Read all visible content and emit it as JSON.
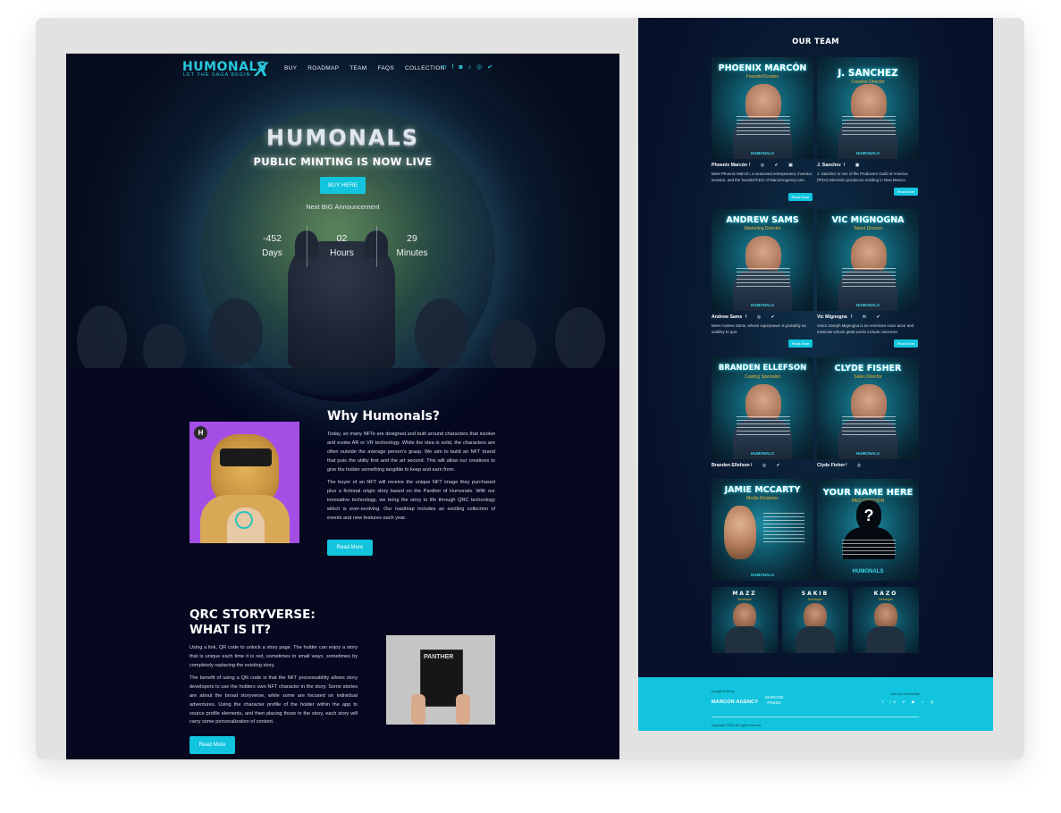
{
  "colors": {
    "accent": "#12c4de",
    "dark_bg": "#05081f",
    "frame_bg": "#e2e2e2",
    "role_gold": "#f2b233"
  },
  "left": {
    "nav": {
      "logo": "HUMONALS",
      "logo_x": "X",
      "logo_tagline": "LET THE SAGA BEGIN",
      "links": [
        "BUY",
        "ROADMAP",
        "TEAM",
        "FAQS",
        "COLLECTION"
      ],
      "social_icons": [
        "linkedin-icon",
        "facebook-icon",
        "discord-icon",
        "tiktok-icon",
        "instagram-icon",
        "twitter-icon"
      ]
    },
    "hero": {
      "title": "HUMONALS",
      "subtitle": "PUBLIC MINTING IS NOW LIVE",
      "buy_label": "BUY HERE",
      "announce": "Next BIG Announcement",
      "countdown": [
        {
          "value": "-452",
          "label": "Days"
        },
        {
          "value": "02",
          "label": "Hours"
        },
        {
          "value": "29",
          "label": "Minutes"
        }
      ]
    },
    "why": {
      "title": "Why Humonals?",
      "p1": "Today, so many NFTs are designed and built around characters that involve and evoke AR or VR technology. While the idea is solid, the characters are often outside the average person's grasp. We aim to build an NFT brand that puts the utility first and the art second. This will allow our creations to give the holder something tangible to keep and earn from.",
      "p2": "The buyer of an NFT will receive the unique NFT image they purchased plus a fictional origin story based on the Panther of Humonals. With our innovative technology, we bring the story to life through QRC technology which is ever-evolving. Our roadmap includes an exciting collection of events and new features each year.",
      "button": "Read More",
      "badge": "H"
    },
    "qrc": {
      "title_line1": "QRC STORYVERSE:",
      "title_line2": "WHAT IS IT?",
      "p1": "Using a link, QR code to unlock a story page. The holder can enjoy a story that is unique each time it is red, sometimes in small ways, sometimes by completely replacing the existing story.",
      "p2": "The benefit of using a QR code is that the NFT processability allows story developers to use the holders own NFT character in the story. Some stories are about the broad storyverse, while some are focused on individual adventures. Using the character profile of the holder within the app to source profile elements, and then placing those in the story, each story will carry some personalization of content.",
      "book_title": "PANTHER",
      "button": "Read More"
    }
  },
  "right": {
    "title": "OUR TEAM",
    "members": [
      {
        "card_name": "PHOENIX MARCÓN",
        "role": "Founder/Creator",
        "name": "Phoenix Marcón",
        "social": "f ◎ ✔ ▣",
        "bio": "Meet Phoenix Marcón, a seasoned entrepreneur, inventor, investor, and the founder/CEO of MarconAgency.com.",
        "button": "Read More"
      },
      {
        "card_name": "J. SANCHEZ",
        "role": "Creative Director",
        "name": "J. Sanchez",
        "social": "f ▣",
        "bio": "J. Sanchez is one of the Producers Guild of America (PGA) television producers residing in New Mexico.",
        "button": "Read More"
      },
      {
        "card_name": "ANDREW SAMS",
        "role": "Marketing Director",
        "name": "Andrew Sams",
        "social": "f ◎ ✔",
        "bio": "Meet Andrew Sams, whose superpower is probably an inability to quit.",
        "button": "Read More"
      },
      {
        "card_name": "VIC MIGNOGNA",
        "role": "Talent Director",
        "name": "Vic Mignogna",
        "social": "f ✉ ✔",
        "bio": "Victor Joseph Mignogna is an American voice actor and musician whose great works include voiceover",
        "button": "Read More"
      },
      {
        "card_name": "BRANDEN ELLEFSON",
        "role": "Casting Specialist",
        "name": "Branden Ellefson",
        "social": "f ◎ ✔"
      },
      {
        "card_name": "CLYDE FISHER",
        "role": "Sales Director",
        "name": "Clyde Fisher",
        "social": "f ◎"
      },
      {
        "card_name": "JAMIE MCCARTY",
        "role": "Media Relations",
        "brand": "HUMONALS"
      },
      {
        "card_name": "YOUR NAME HERE",
        "role": "PAID POSITION",
        "mystery": "?",
        "brand": "HUMONALS"
      }
    ],
    "small_members": [
      {
        "card_name": "MAZZ",
        "role": "Developer"
      },
      {
        "card_name": "SAKIB",
        "role": "Developer"
      },
      {
        "card_name": "KAZO",
        "role": "Developer"
      }
    ],
    "card_brand": "HUMONALS",
    "footer": {
      "brought": "brought to life by",
      "logo1": "MARCON AGENCY",
      "logo2_line1": "MARCON",
      "logo2_line2": "PRESS",
      "join": "Join Our Community!",
      "social": "f in ✔ ▶ ♪ ◎",
      "copyright": "Copyright ©2022 All rights reserved"
    }
  }
}
